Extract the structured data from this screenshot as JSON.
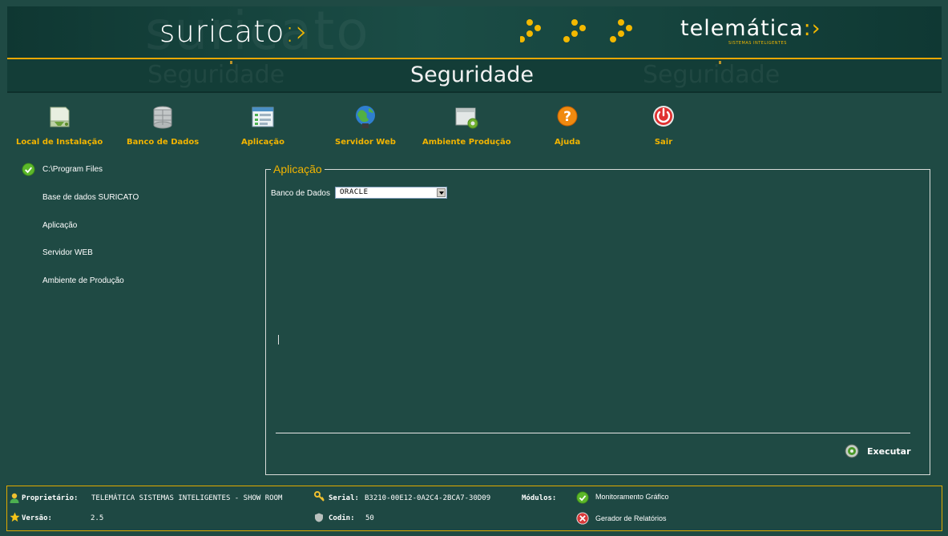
{
  "banner": {
    "logo": "suricato",
    "logo_arrows": ":›",
    "watermark": "suricato",
    "company": "telemática",
    "company_arrows": ":›",
    "company_sub": "SISTEMAS INTELIGENTES"
  },
  "titlebar": {
    "title": "Seguridade",
    "ghost_left": "Seguridade",
    "ghost_right": "Seguridade"
  },
  "toolbar": {
    "items": [
      {
        "label": "Local de Instalação",
        "icon": "drive-icon"
      },
      {
        "label": "Banco de Dados",
        "icon": "database-icon"
      },
      {
        "label": "Aplicação",
        "icon": "application-window-icon"
      },
      {
        "label": "Servidor Web",
        "icon": "globe-icon"
      },
      {
        "label": "Ambiente Produção",
        "icon": "window-gear-icon"
      },
      {
        "label": "Ajuda",
        "icon": "help-icon"
      },
      {
        "label": "Sair",
        "icon": "power-icon"
      }
    ]
  },
  "steps": [
    {
      "label": "C:\\Program Files",
      "done": true
    },
    {
      "label": "Base de dados SURICATO",
      "done": false
    },
    {
      "label": "Aplicação",
      "done": false
    },
    {
      "label": "Servidor WEB",
      "done": false
    },
    {
      "label": "Ambiente de Produção",
      "done": false
    }
  ],
  "panel": {
    "legend": "Aplicação",
    "field_label": "Banco de Dados",
    "db_selected": "ORACLE",
    "execute_label": "Executar"
  },
  "footer": {
    "owner_label": "Proprietário:",
    "owner_value": "TELEMÁTICA SISTEMAS INTELIGENTES - SHOW ROOM",
    "serial_label": "Serial:",
    "serial_value": "B3210-00E12-0A2C4-2BCA7-30D09",
    "modules_label": "Módulos:",
    "module_1": "Monitoramento Gráfico",
    "module_2": "Gerador de Relatórios",
    "version_label": "Versão:",
    "version_value": "2.5",
    "codin_label": "Codin:",
    "codin_value": "50"
  },
  "colors": {
    "background": "#1f4a44",
    "accent": "#f2b400",
    "ok": "#5cb82a",
    "error": "#d83a3a"
  }
}
